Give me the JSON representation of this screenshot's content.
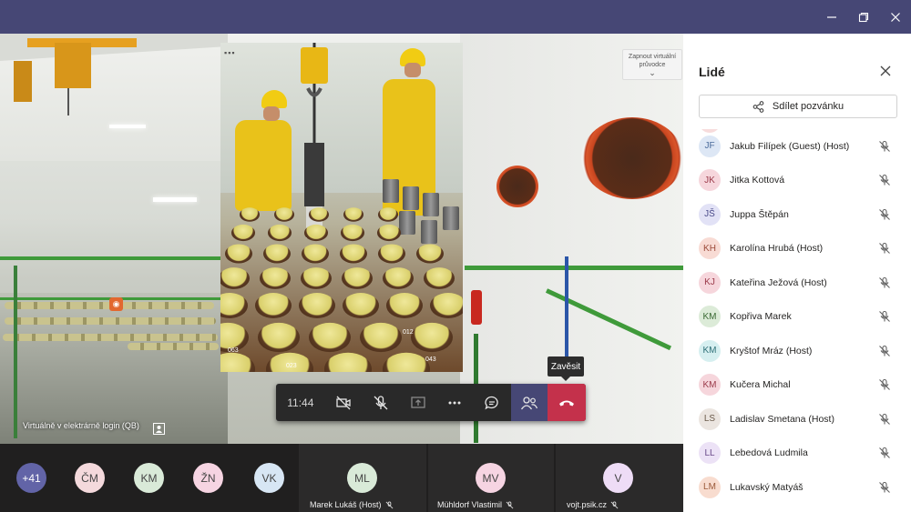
{
  "window": {
    "minimize_icon": "minimize-icon",
    "restore_icon": "restore-icon",
    "close_icon": "close-icon"
  },
  "stage": {
    "tour_button_label": "Zapnout virtuální průvodce",
    "stage_label": "Virtuálně v elektrárně login (QB)",
    "fuel_labels": [
      "023",
      "012",
      "063",
      "043"
    ]
  },
  "toolbar": {
    "timer": "11:44",
    "hangup_tooltip": "Zavěsit"
  },
  "strip": {
    "overflow_count": "+41",
    "avatars": [
      {
        "initials": "ČM",
        "color": "#f4d9dc"
      },
      {
        "initials": "KM",
        "color": "#d9ead8"
      },
      {
        "initials": "ŽN",
        "color": "#f6d4e2"
      },
      {
        "initials": "VK",
        "color": "#d7e6f4"
      }
    ],
    "tiles": [
      {
        "initials": "ML",
        "name": "Marek Lukáš (Host)",
        "color": "#d9ead8"
      },
      {
        "initials": "MV",
        "name": "Mühldorf Vlastimil",
        "color": "#f6d4e2"
      },
      {
        "initials": "V",
        "name": "vojt.psik.cz",
        "color": "#eedcf6"
      }
    ]
  },
  "panel": {
    "title": "Lidé",
    "invite_label": "Sdílet pozvánku",
    "people": [
      {
        "initials": "JF",
        "name": "Jakub Filípek (Guest) (Host)",
        "bg": "#dde7f5",
        "fg": "#4a6a9a"
      },
      {
        "initials": "JK",
        "name": "Jitka Kottová",
        "bg": "#f6d6dc",
        "fg": "#9b3a4a"
      },
      {
        "initials": "JŠ",
        "name": "Juppa Štěpán",
        "bg": "#e2e2f6",
        "fg": "#4a4a8a"
      },
      {
        "initials": "KH",
        "name": "Karolína Hrubá (Host)",
        "bg": "#f8dbd4",
        "fg": "#9b4a3a"
      },
      {
        "initials": "KJ",
        "name": "Kateřina Ježová (Host)",
        "bg": "#f6d6dc",
        "fg": "#9b3a4a"
      },
      {
        "initials": "KM",
        "name": "Kopřiva Marek",
        "bg": "#dcebd8",
        "fg": "#3a6a34"
      },
      {
        "initials": "KM",
        "name": "Kryštof Mráz (Host)",
        "bg": "#d6eff0",
        "fg": "#2f7078"
      },
      {
        "initials": "KM",
        "name": "Kučera Michal",
        "bg": "#f6d6dc",
        "fg": "#9b3a4a"
      },
      {
        "initials": "LS",
        "name": "Ladislav Smetana (Host)",
        "bg": "#ebe5e0",
        "fg": "#6a5a4a"
      },
      {
        "initials": "LL",
        "name": "Lebedová Ludmila",
        "bg": "#ece2f6",
        "fg": "#6a4a8a"
      },
      {
        "initials": "LM",
        "name": "Lukavský Matyáš",
        "bg": "#f8dccf",
        "fg": "#9b5a3a"
      }
    ]
  }
}
